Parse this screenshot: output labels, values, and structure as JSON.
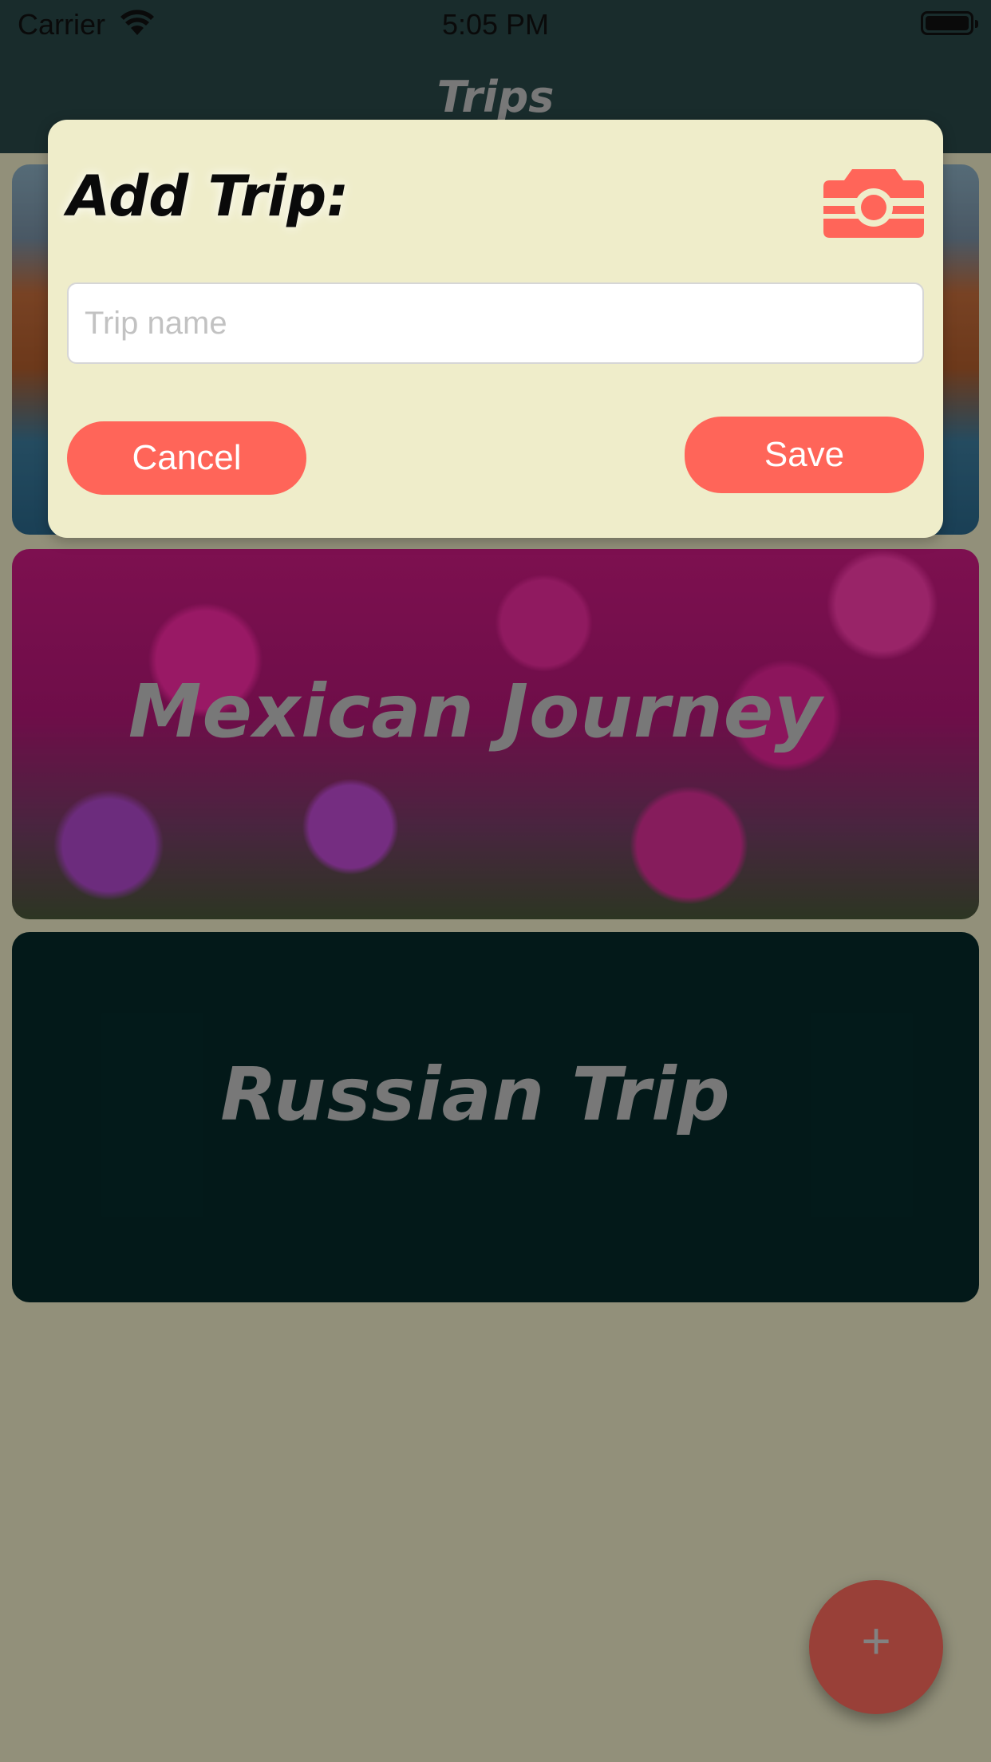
{
  "status_bar": {
    "carrier": "Carrier",
    "time": "5:05 PM"
  },
  "nav": {
    "title": "Trips"
  },
  "trips": [
    {
      "title": ""
    },
    {
      "title": "Mexican Journey"
    },
    {
      "title": "Russian Trip"
    }
  ],
  "dialog": {
    "title": "Add Trip:",
    "camera_icon": "camera-icon",
    "input_placeholder": "Trip name",
    "input_value": "",
    "cancel_label": "Cancel",
    "save_label": "Save"
  },
  "fab": {
    "label": "+",
    "icon": "plus-icon"
  },
  "colors": {
    "nav_background": "#2b4a4a",
    "accent": "#ff6559",
    "dialog_background": "#efedca",
    "russian_card_background": "#052b2b"
  }
}
